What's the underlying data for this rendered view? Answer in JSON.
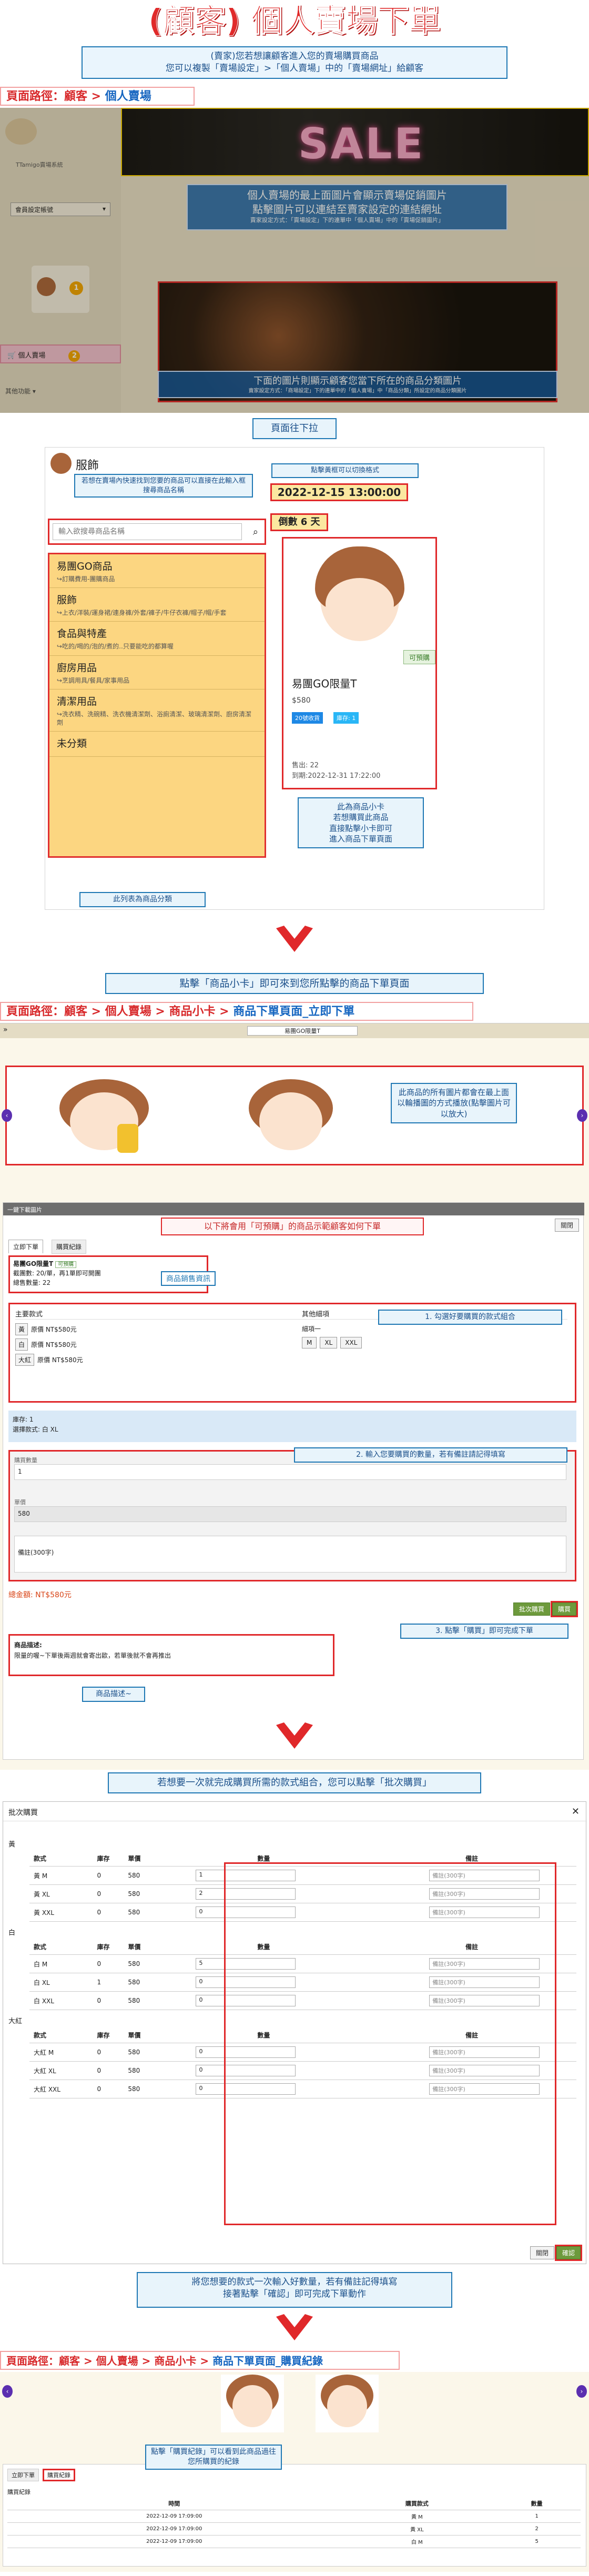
{
  "colors": {
    "red": "#e0282a",
    "blue": "#1f78b4",
    "gold": "#fcd681",
    "green": "#6d9a3c"
  },
  "header": {
    "title": "(顧客) 個人賣場下單",
    "subtitle_1": "(賣家)您若想讓顧客進入您的賣場購買商品",
    "subtitle_2": "您可以複製「賣場設定」>「個人賣場」中的「賣場網址」給顧客"
  },
  "section1": {
    "path_prefix": "頁面路徑：顧客 > ",
    "path_end": "個人賣場",
    "sidebar": {
      "brand": "TTamigo賣場系統",
      "dropdown": "會員設定帳號",
      "cart": "購物車",
      "cart_count": "1",
      "my_shop": "個人賣場",
      "shop_count": "2",
      "other": "其他功能"
    },
    "banner_sale": "SALE",
    "ann1_line1": "個人賣場的最上面圖片會顯示賣場促銷圖片",
    "ann1_line2": "點擊圖片可以連結至賣家設定的連結網址",
    "ann1_small": "賣家設定方式：「賣場設定」下的連單中「個人賣場」中的「賣場促銷圖片」",
    "ann2_line1": "下面的圖片則顯示顧客您當下所在的商品分類圖片",
    "ann2_small": "賣家設定方式：「商場設定」下的連單中的「個人賣場」中「商品分類」所設定的商品分類圖片"
  },
  "scroll_label": "頁面往下拉",
  "section2": {
    "seller_name": "服飾",
    "ann_search": "若想在賣場內快速找到您要的商品可以直接在此輸入框搜尋商品名稱",
    "search_placeholder": "輸入欲搜尋商品名稱",
    "ann_toggle": "點擊黃框可以切換格式",
    "deadline": "2022-12-15 13:00:00",
    "countdown": "倒數 6 天",
    "categories": [
      {
        "name": "易團GO商品",
        "desc": "↪訂購費用-團購商品"
      },
      {
        "name": "服飾",
        "desc": "↪上衣/洋裝/運身裙/連身褲/外套/褲子/牛仔衣褲/帽子/帽/手套"
      },
      {
        "name": "食品與特產",
        "desc": "↪吃的/喝的/泡的/煮的..只要能吃的都算喔"
      },
      {
        "name": "廚房用品",
        "desc": "↪烹調用具/餐具/家事用品"
      },
      {
        "name": "清潔用品",
        "desc": "↪洗衣精、洗碗精、洗衣機清潔劑、浴廁清潔、玻璃清潔劑、廚房清潔劑"
      },
      {
        "name": "未分類",
        "desc": ""
      }
    ],
    "ann_categories": "此列表為商品分類",
    "product": {
      "badge": "可預購",
      "name": "易團GO限量T",
      "price": "$580",
      "tag1": "20號收貨",
      "tag2": "庫存: 1",
      "sold": "售出: 22",
      "until": "到期:2022-12-31 17:22:00"
    },
    "ann_card_1": "此為商品小卡",
    "ann_card_2": "若想購買此商品",
    "ann_card_3": "直接點擊小卡即可",
    "ann_card_4": "進入商品下單頁面"
  },
  "instr3": "點擊「商品小卡」即可來到您所點擊的商品下單頁面",
  "section3": {
    "path_prefix": "頁面路徑：顧客 > 個人賣場 > 商品小卡 > ",
    "path_end": "商品下單頁面_立即下單",
    "top_bar": "易團GO限量T",
    "ann_gallery": "此商品的所有圖片都會在最上面以輪播圖的方式播放(點擊圖片可以放大)",
    "panel_title": "一鍵下載圖片",
    "close": "關閉",
    "ann_preorder": "以下將會用「可預購」的商品示範顧客如何下單",
    "tab_order": "立即下單",
    "tab_history": "購買紀錄",
    "info_name": "易團GO限量T",
    "info_badge": "可預購",
    "info_deadline": "截團數: 20/單，再1單即可開團",
    "info_sold": "總售數量: 22",
    "ann_info": "商品銷售資訊",
    "style_head": "主要款式",
    "size_head": "其他細項",
    "size_sub": "細項一",
    "styles": [
      {
        "name": "黃",
        "price": "原價 NT$580元"
      },
      {
        "name": "白",
        "price": "原價 NT$580元"
      },
      {
        "name": "大紅",
        "price": "原價 NT$580元"
      }
    ],
    "sizes": [
      "M",
      "XL",
      "XXL"
    ],
    "ann_style": "1. 勾選好要購買的款式組合",
    "stock": "庫存: 1",
    "selected": "選擇款式: 白 XL",
    "qty_label": "購買數量",
    "qty_value": "1",
    "price_label": "單價",
    "price_value": "580",
    "note_label": "備註(300字)",
    "ann_qty": "2. 輸入您要購買的數量，若有備註請記得填寫",
    "total": "總金額: NT$580元",
    "btn_batch": "批次購買",
    "btn_buy": "購買",
    "ann_buy": "3. 點擊「購買」即可完成下單",
    "desc_title": "商品描述:",
    "desc_text": "限量的喔~下單後兩週就會寄出歐，若單後就不會再推出",
    "ann_desc": "商品描述~"
  },
  "instr4": "若想要一次就完成購買所需的款式組合，您可以點擊「批次購買」",
  "section4": {
    "modal_title": "批次購買",
    "headers": [
      "款式",
      "庫存",
      "單價",
      "數量",
      "備註"
    ],
    "note_ph": "備註(300字)",
    "groups": [
      {
        "name": "黃",
        "rows": [
          {
            "item": "黃 M",
            "stock": "0",
            "price": "580",
            "qty": "1"
          },
          {
            "item": "黃 XL",
            "stock": "0",
            "price": "580",
            "qty": "2"
          },
          {
            "item": "黃 XXL",
            "stock": "0",
            "price": "580",
            "qty": "0"
          }
        ]
      },
      {
        "name": "白",
        "rows": [
          {
            "item": "白 M",
            "stock": "0",
            "price": "580",
            "qty": "5"
          },
          {
            "item": "白 XL",
            "stock": "1",
            "price": "580",
            "qty": "0"
          },
          {
            "item": "白 XXL",
            "stock": "0",
            "price": "580",
            "qty": "0"
          }
        ]
      },
      {
        "name": "大紅",
        "rows": [
          {
            "item": "大紅 M",
            "stock": "0",
            "price": "580",
            "qty": "0"
          },
          {
            "item": "大紅 XL",
            "stock": "0",
            "price": "580",
            "qty": "0"
          },
          {
            "item": "大紅 XXL",
            "stock": "0",
            "price": "580",
            "qty": "0"
          }
        ]
      }
    ],
    "btn_close": "關閉",
    "btn_submit": "確認",
    "ann_batch_1": "將您想要的款式一次輸入好數量，若有備註記得填寫",
    "ann_batch_2": "接著點擊「確認」即可完成下單動作"
  },
  "section5": {
    "path_prefix": "頁面路徑：顧客 > 個人賣場 > 商品小卡 > ",
    "path_end": "商品下單頁面_購買紀錄",
    "tab_order": "立即下單",
    "tab_history": "購買紀錄",
    "ann_history": "點擊「購買紀錄」可以看到此商品過往您所購買的紀錄",
    "panel_title": "購買紀錄",
    "headers": [
      "時間",
      "購買款式",
      "數量"
    ],
    "rows": [
      {
        "time": "2022-12-09 17:09:00",
        "style": "黃 M",
        "qty": "1"
      },
      {
        "time": "2022-12-09 17:09:00",
        "style": "黃 XL",
        "qty": "2"
      },
      {
        "time": "2022-12-09 17:09:00",
        "style": "白 M",
        "qty": "5"
      }
    ]
  }
}
